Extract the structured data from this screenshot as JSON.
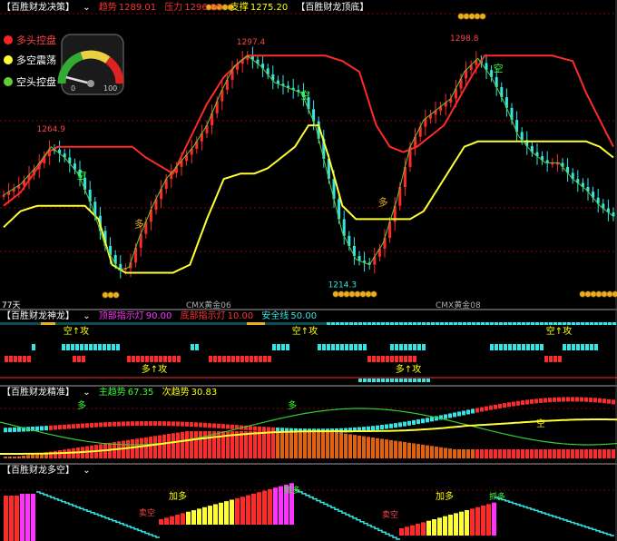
{
  "colors": {
    "bg": "#000000",
    "red": "#ff2a2a",
    "cyan": "#33e6e6",
    "yellow": "#ffff33",
    "green": "#33cc33",
    "gold": "#e8b020",
    "magenta": "#ff33ff",
    "grid": "#8b0000",
    "label_red": "#ff4444",
    "label_green": "#33ff33",
    "label_yellow": "#ffff00",
    "label_cyan": "#33e6e6"
  },
  "panel1": {
    "title": "【百胜财龙决策】",
    "trend_label": "趋势",
    "trend_value": "1289.01",
    "pressure_label": "压力",
    "pressure_value": "1296.95",
    "support_label": "支撑",
    "support_value": "1275.20",
    "extra_title": "【百胜财龙顶底】",
    "legend": [
      "多头控盘",
      "多空震荡",
      "空头控盘"
    ],
    "gauge_min": "0",
    "gauge_max": "100",
    "gauge_level": 0.08,
    "bottom_left": "77天",
    "bottom_marks": [
      "CMX黄金06",
      "CMX黄金08"
    ]
  },
  "panel2": {
    "title": "【百胜财龙神龙】",
    "top_label": "顶部指示灯",
    "top_value": "90.00",
    "bottom_label": "底部指示灯",
    "bottom_value": "10.00",
    "safe_label": "安全线",
    "safe_value": "50.00"
  },
  "panel3": {
    "title": "【百胜财龙精准】",
    "main_label": "主趋势",
    "main_value": "67.35",
    "sub_label": "次趋势",
    "sub_value": "30.83"
  },
  "panel4": {
    "title": "【百胜财龙多空】"
  },
  "chart_data": [
    {
      "type": "line",
      "title": "百胜财龙决策",
      "ylim": [
        1205,
        1310
      ],
      "annotations": [
        {
          "text": "1264.9",
          "x": 14,
          "y": 1264.9
        },
        {
          "text": "1297.4",
          "x": 73,
          "y": 1297.4
        },
        {
          "text": "1214.3",
          "x": 100,
          "y": 1214.3
        },
        {
          "text": "1298.8",
          "x": 136,
          "y": 1298.8
        },
        {
          "text": "空",
          "x": 23,
          "y": 1250
        },
        {
          "text": "多",
          "x": 40,
          "y": 1232
        },
        {
          "text": "空",
          "x": 89,
          "y": 1280
        },
        {
          "text": "多",
          "x": 112,
          "y": 1240
        },
        {
          "text": "空",
          "x": 146,
          "y": 1290
        }
      ],
      "series": [
        {
          "name": "压力",
          "color": "#ff2a2a",
          "x": [
            0,
            5,
            10,
            13,
            16,
            20,
            25,
            30,
            35,
            38,
            42,
            50,
            55,
            60,
            65,
            70,
            72,
            76,
            80,
            85,
            90,
            95,
            100,
            105,
            110,
            114,
            118,
            122,
            130,
            138,
            142,
            150,
            156,
            162,
            168,
            172,
            176,
            180
          ],
          "values": [
            1240,
            1245,
            1254,
            1260,
            1262,
            1262,
            1262,
            1262,
            1262,
            1262,
            1258,
            1252,
            1265,
            1278,
            1288,
            1294,
            1296,
            1296,
            1296,
            1296,
            1296,
            1296,
            1294,
            1290,
            1270,
            1262,
            1260,
            1262,
            1270,
            1288,
            1296,
            1296,
            1296,
            1296,
            1294,
            1282,
            1272,
            1262
          ]
        },
        {
          "name": "支撑",
          "color": "#ffff33",
          "x": [
            0,
            5,
            10,
            13,
            16,
            20,
            24,
            28,
            32,
            36,
            38,
            42,
            50,
            55,
            60,
            65,
            70,
            74,
            78,
            82,
            86,
            90,
            93,
            96,
            100,
            104,
            108,
            112,
            116,
            120,
            124,
            130,
            136,
            140,
            144,
            148,
            152,
            156,
            160,
            164,
            168,
            172,
            176,
            180
          ],
          "values": [
            1232,
            1238,
            1240,
            1240,
            1240,
            1240,
            1240,
            1235,
            1218,
            1215,
            1215,
            1215,
            1215,
            1218,
            1235,
            1250,
            1252,
            1252,
            1254,
            1258,
            1262,
            1270,
            1270,
            1258,
            1240,
            1235,
            1235,
            1235,
            1235,
            1235,
            1238,
            1250,
            1262,
            1264,
            1264,
            1264,
            1264,
            1264,
            1264,
            1264,
            1264,
            1264,
            1262,
            1258
          ]
        },
        {
          "name": "价格",
          "color": "#33cc33",
          "x": [
            0,
            5,
            10,
            14,
            18,
            22,
            26,
            30,
            34,
            37,
            40,
            44,
            48,
            52,
            56,
            60,
            64,
            68,
            72,
            76,
            80,
            84,
            88,
            92,
            96,
            100,
            104,
            108,
            112,
            116,
            120,
            124,
            128,
            132,
            136,
            140,
            144,
            148,
            152,
            156,
            160,
            164,
            168,
            172,
            176,
            180
          ],
          "values": [
            1244,
            1248,
            1255,
            1262,
            1258,
            1252,
            1240,
            1225,
            1216,
            1217,
            1228,
            1240,
            1250,
            1256,
            1262,
            1270,
            1282,
            1292,
            1296,
            1292,
            1286,
            1284,
            1282,
            1270,
            1250,
            1230,
            1220,
            1218,
            1226,
            1242,
            1262,
            1272,
            1276,
            1280,
            1290,
            1295,
            1288,
            1278,
            1266,
            1260,
            1256,
            1256,
            1250,
            1246,
            1240,
            1236
          ]
        }
      ]
    },
    {
      "type": "bar",
      "title": "百胜财龙神龙",
      "annotations": [
        {
          "text": "空↑攻"
        },
        {
          "text": "空↑攻"
        },
        {
          "text": "空↑攻"
        },
        {
          "text": "多↑攻"
        },
        {
          "text": "多↑攻"
        }
      ],
      "series": [
        {
          "name": "顶部指示灯",
          "value": 90.0,
          "color": "#ff33ff"
        },
        {
          "name": "底部指示灯",
          "value": 10.0,
          "color": "#ff2a2a"
        },
        {
          "name": "安全线",
          "value": 50.0,
          "color": "#33e6e6"
        }
      ]
    },
    {
      "type": "line",
      "title": "百胜财龙精准",
      "annotations": [
        {
          "text": "多"
        },
        {
          "text": "多"
        },
        {
          "text": "空"
        }
      ],
      "series": [
        {
          "name": "主趋势",
          "value": 67.35,
          "color": "#33ff33"
        },
        {
          "name": "次趋势",
          "value": 30.83,
          "color": "#ffff00"
        }
      ]
    },
    {
      "type": "bar",
      "title": "百胜财龙多空",
      "annotations": [
        {
          "text": "卖空"
        },
        {
          "text": "加多"
        },
        {
          "text": "抓多"
        },
        {
          "text": "卖空"
        },
        {
          "text": "加多"
        },
        {
          "text": "抓多"
        }
      ]
    }
  ]
}
